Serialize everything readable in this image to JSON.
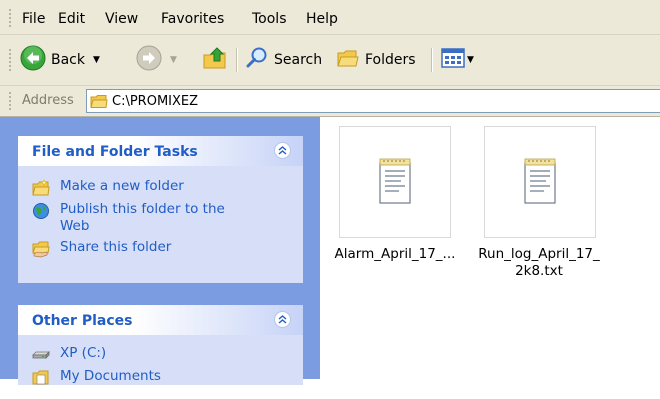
{
  "menu": {
    "items": [
      "File",
      "Edit",
      "View",
      "Favorites",
      "Tools",
      "Help"
    ]
  },
  "toolbar": {
    "back_label": "Back",
    "search_label": "Search",
    "folders_label": "Folders"
  },
  "address": {
    "label": "Address",
    "path": "C:\\PROMIXEZ"
  },
  "tasks_panel": {
    "title": "File and Folder Tasks",
    "items": [
      {
        "label": "Make a new folder",
        "icon": "new-folder-icon"
      },
      {
        "label": "Publish this folder to the Web",
        "icon": "publish-web-icon"
      },
      {
        "label": "Share this folder",
        "icon": "share-folder-icon"
      }
    ]
  },
  "places_panel": {
    "title": "Other Places",
    "items": [
      {
        "label": "XP (C:)",
        "icon": "drive-icon"
      },
      {
        "label": "My Documents",
        "icon": "my-documents-icon"
      }
    ]
  },
  "files": [
    {
      "name": "Alarm_April_17_...",
      "icon": "text-file-icon"
    },
    {
      "name": "Run_log_April_17_\n2k8.txt",
      "icon": "text-file-icon"
    }
  ],
  "colors": {
    "chrome": "#ece9d8",
    "task_pane": "#7b9ce0",
    "panel_body": "#d6dff7",
    "link": "#215dc6"
  }
}
